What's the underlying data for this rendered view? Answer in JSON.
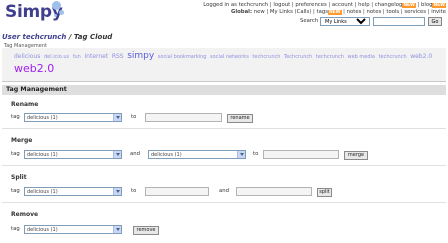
{
  "logo": {
    "text": "Simpy"
  },
  "topnav": {
    "row1": [
      "Logged in as techcrunch",
      "logout",
      "preferences",
      "account",
      "help",
      "changelog",
      "blog"
    ],
    "row1_new": [
      "NEW",
      "NEW"
    ],
    "row2_prefix": "Global:",
    "row2": [
      "new",
      "My Links",
      "Calls",
      "tags",
      "notes",
      "notes",
      "tools",
      "services",
      "invite"
    ],
    "row2_new": "NEW",
    "separator": "|"
  },
  "search": {
    "label": "Search",
    "scope": "My Links",
    "query": "",
    "button": "Go"
  },
  "page_title": {
    "user": "User techcrunch",
    "sep": "/",
    "section": "Tag Cloud"
  },
  "breadcrumb": "Tag Management",
  "tag_cloud": [
    {
      "t": "delicious",
      "s": "md"
    },
    {
      "t": "del.icio.us",
      "s": "sm"
    },
    {
      "t": "fun",
      "s": "sm"
    },
    {
      "t": "Internet",
      "s": "md"
    },
    {
      "t": "RSS",
      "s": "md"
    },
    {
      "t": "simpy",
      "s": "lg"
    },
    {
      "t": "social bookmarking",
      "s": "sm"
    },
    {
      "t": "social networks",
      "s": "sm"
    },
    {
      "t": "techcrunch",
      "s": "sm"
    },
    {
      "t": "Techcrunch",
      "s": "sm"
    },
    {
      "t": "techcrunch",
      "s": "sm"
    },
    {
      "t": "web media",
      "s": "sm"
    },
    {
      "t": "techcrunch",
      "s": "sm"
    },
    {
      "t": "web2.0",
      "s": "md"
    },
    {
      "t": "web2.0",
      "s": "xl"
    }
  ],
  "tag_management": {
    "heading": "Tag Management",
    "tag_label": "tag",
    "rename": {
      "title": "Rename",
      "tag_value": "delicious (1)",
      "to_label": "to",
      "new_name": "",
      "button": "rename"
    },
    "merge": {
      "title": "Merge",
      "tag1": "delicious (1)",
      "and_label": "and",
      "tag2": "delicious (1)",
      "to_label": "to",
      "new_name": "",
      "button": "merge"
    },
    "split": {
      "title": "Split",
      "tag_value": "delicious (1)",
      "to_label": "to",
      "name1": "",
      "and_label": "and",
      "name2": "",
      "button": "split"
    },
    "remove": {
      "title": "Remove",
      "tag_value": "delicious (1)",
      "button": "remove"
    }
  },
  "colors": {
    "logo": "#3f3f8f",
    "cloud_link": "#9090e0",
    "cloud_accent": "#a020f0",
    "new_badge": "#ff9a2e",
    "heading_bg": "#dedede"
  }
}
